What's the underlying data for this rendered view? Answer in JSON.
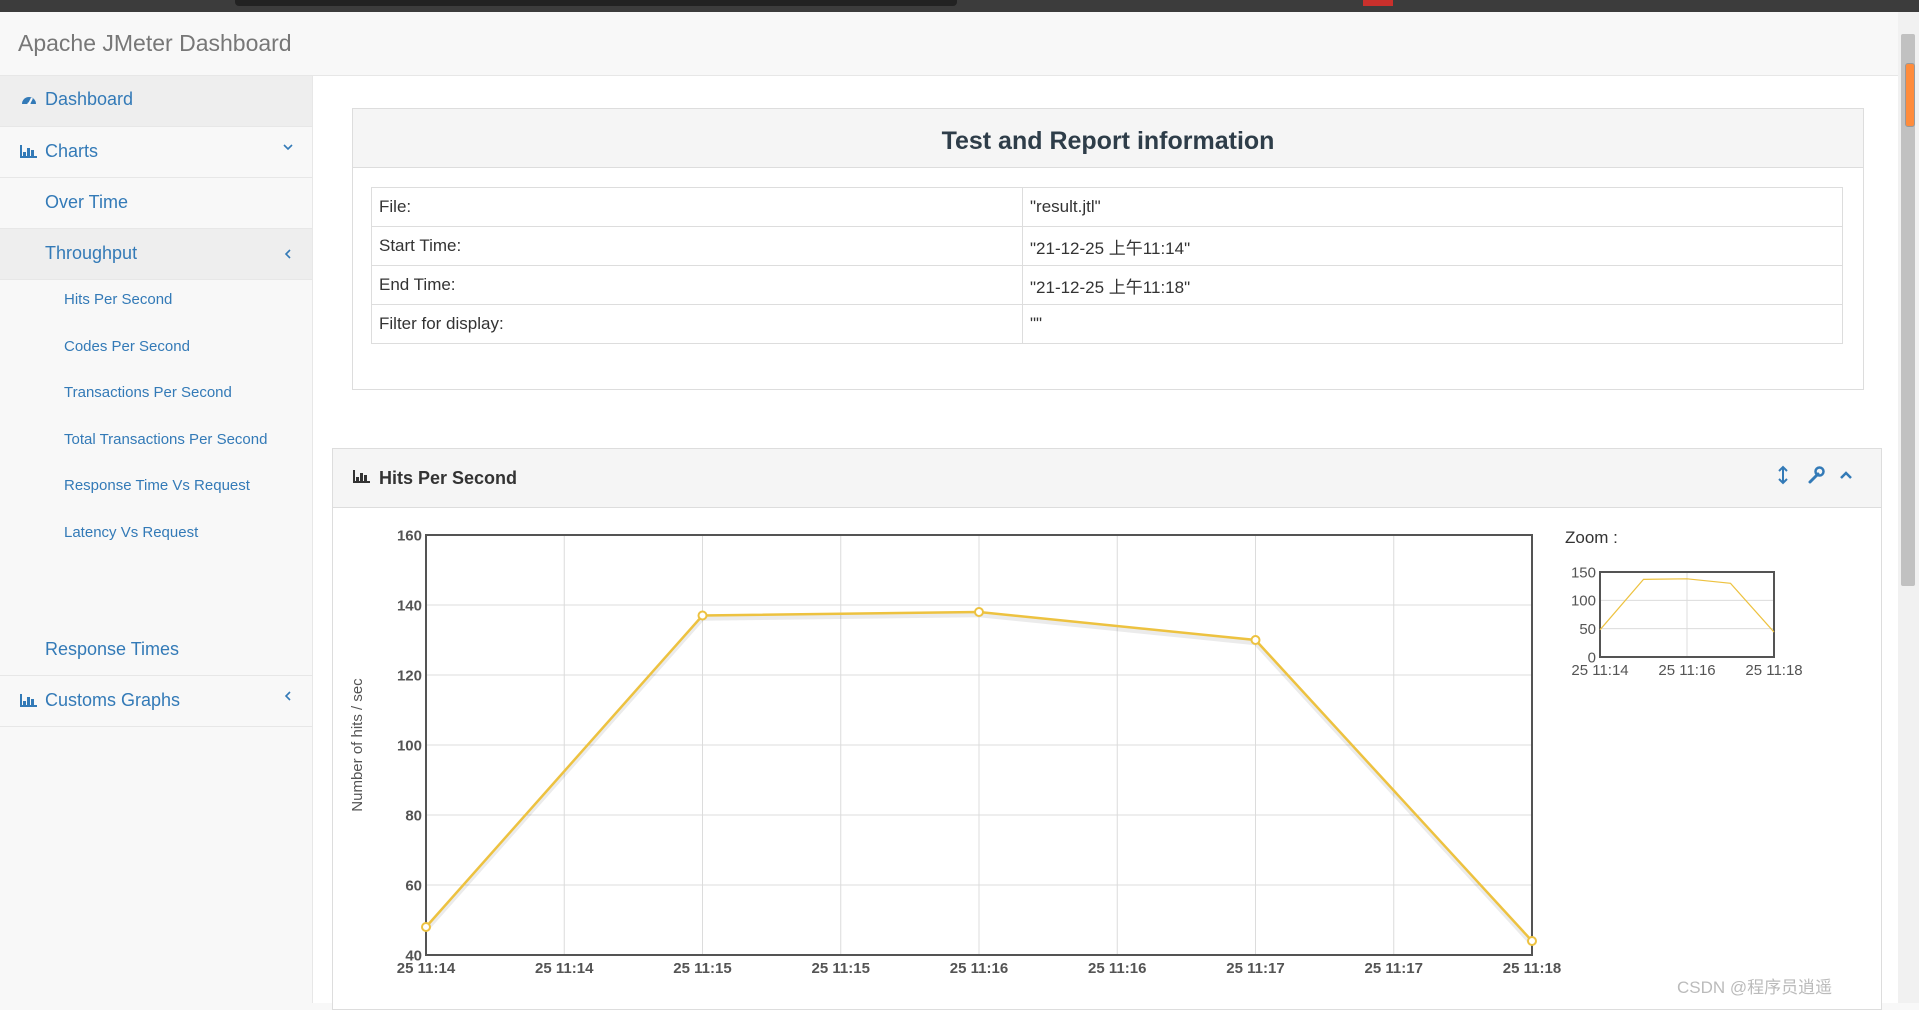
{
  "app": {
    "brand": "Apache JMeter Dashboard"
  },
  "sidebar": {
    "dashboard": "Dashboard",
    "charts": "Charts",
    "over_time": "Over Time",
    "throughput": "Throughput",
    "sub_items": [
      "Hits Per Second",
      "Codes Per Second",
      "Transactions Per Second",
      "Total Transactions Per Second",
      "Response Time Vs Request",
      "Latency Vs Request"
    ],
    "response_times": "Response Times",
    "customs_graphs": "Customs Graphs"
  },
  "info": {
    "title": "Test and Report information",
    "rows": [
      {
        "key": "File:",
        "value": "\"result.jtl\""
      },
      {
        "key": "Start Time:",
        "value": "\"21-12-25 上午11:14\""
      },
      {
        "key": "End Time:",
        "value": "\"21-12-25 上午11:18\""
      },
      {
        "key": "Filter for display:",
        "value": "\"\""
      }
    ]
  },
  "chart_panel": {
    "title": "Hits Per Second",
    "icons": [
      "resize-vertical-icon",
      "wrench-icon",
      "chevron-up-icon"
    ]
  },
  "chart_data": [
    {
      "type": "line",
      "ylabel": "Number of hits / sec",
      "ylim": [
        40,
        160
      ],
      "y_ticks": [
        40,
        60,
        80,
        100,
        120,
        140,
        160
      ],
      "x_tick_labels": [
        "25 11:14",
        "25 11:14",
        "25 11:15",
        "25 11:15",
        "25 11:16",
        "25 11:16",
        "25 11:17",
        "25 11:17",
        "25 11:18"
      ],
      "x": [
        0,
        2,
        4,
        6,
        8
      ],
      "series": [
        {
          "values": [
            48,
            137,
            138,
            130,
            44
          ],
          "color": "#edc240"
        }
      ],
      "grid": true
    },
    {
      "type": "line",
      "title": "Zoom :",
      "ylim": [
        0,
        150
      ],
      "y_ticks": [
        0,
        50,
        100,
        150
      ],
      "x_tick_labels": [
        "25 11:14",
        "25 11:16",
        "25 11:18"
      ],
      "x": [
        0,
        1,
        2,
        3,
        4
      ],
      "series": [
        {
          "values": [
            48,
            137,
            138,
            130,
            44
          ],
          "color": "#edc240"
        }
      ],
      "grid": true
    }
  ],
  "watermark": "CSDN @程序员逍遥"
}
